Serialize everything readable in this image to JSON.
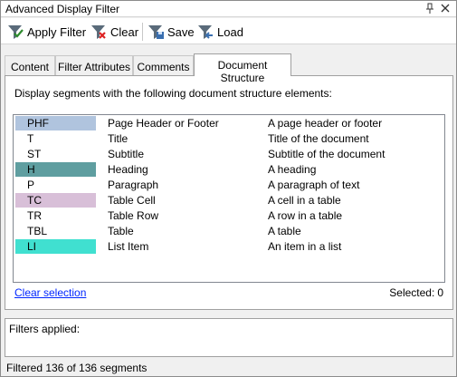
{
  "window": {
    "title": "Advanced Display Filter"
  },
  "toolbar": {
    "apply_label": "Apply Filter",
    "clear_label": "Clear",
    "save_label": "Save",
    "load_label": "Load"
  },
  "tabs": [
    {
      "label": "Content",
      "active": false
    },
    {
      "label": "Filter Attributes",
      "active": false
    },
    {
      "label": "Comments",
      "active": false
    },
    {
      "label": "Document Structure",
      "active": true
    }
  ],
  "panel": {
    "description": "Display segments with the following document structure elements:",
    "rows": [
      {
        "code": "PHF",
        "name": "Page Header or Footer",
        "desc": "A page header or footer",
        "color": "#b0c4de"
      },
      {
        "code": "T",
        "name": "Title",
        "desc": "Title of the document",
        "color": ""
      },
      {
        "code": "ST",
        "name": "Subtitle",
        "desc": "Subtitle of the document",
        "color": ""
      },
      {
        "code": "H",
        "name": "Heading",
        "desc": "A heading",
        "color": "#5f9ea0"
      },
      {
        "code": "P",
        "name": "Paragraph",
        "desc": "A paragraph of text",
        "color": ""
      },
      {
        "code": "TC",
        "name": "Table Cell",
        "desc": "A cell in a table",
        "color": "#d8bfd8"
      },
      {
        "code": "TR",
        "name": "Table Row",
        "desc": "A row in a table",
        "color": ""
      },
      {
        "code": "TBL",
        "name": "Table",
        "desc": "A table",
        "color": ""
      },
      {
        "code": "LI",
        "name": "List Item",
        "desc": "An item in a list",
        "color": "#40e0d0"
      }
    ],
    "clear_selection": "Clear selection",
    "selected_label": "Selected:",
    "selected_count": "0"
  },
  "filters": {
    "label": "Filters applied:"
  },
  "status": {
    "text": "Filtered 136 of 136 segments"
  }
}
